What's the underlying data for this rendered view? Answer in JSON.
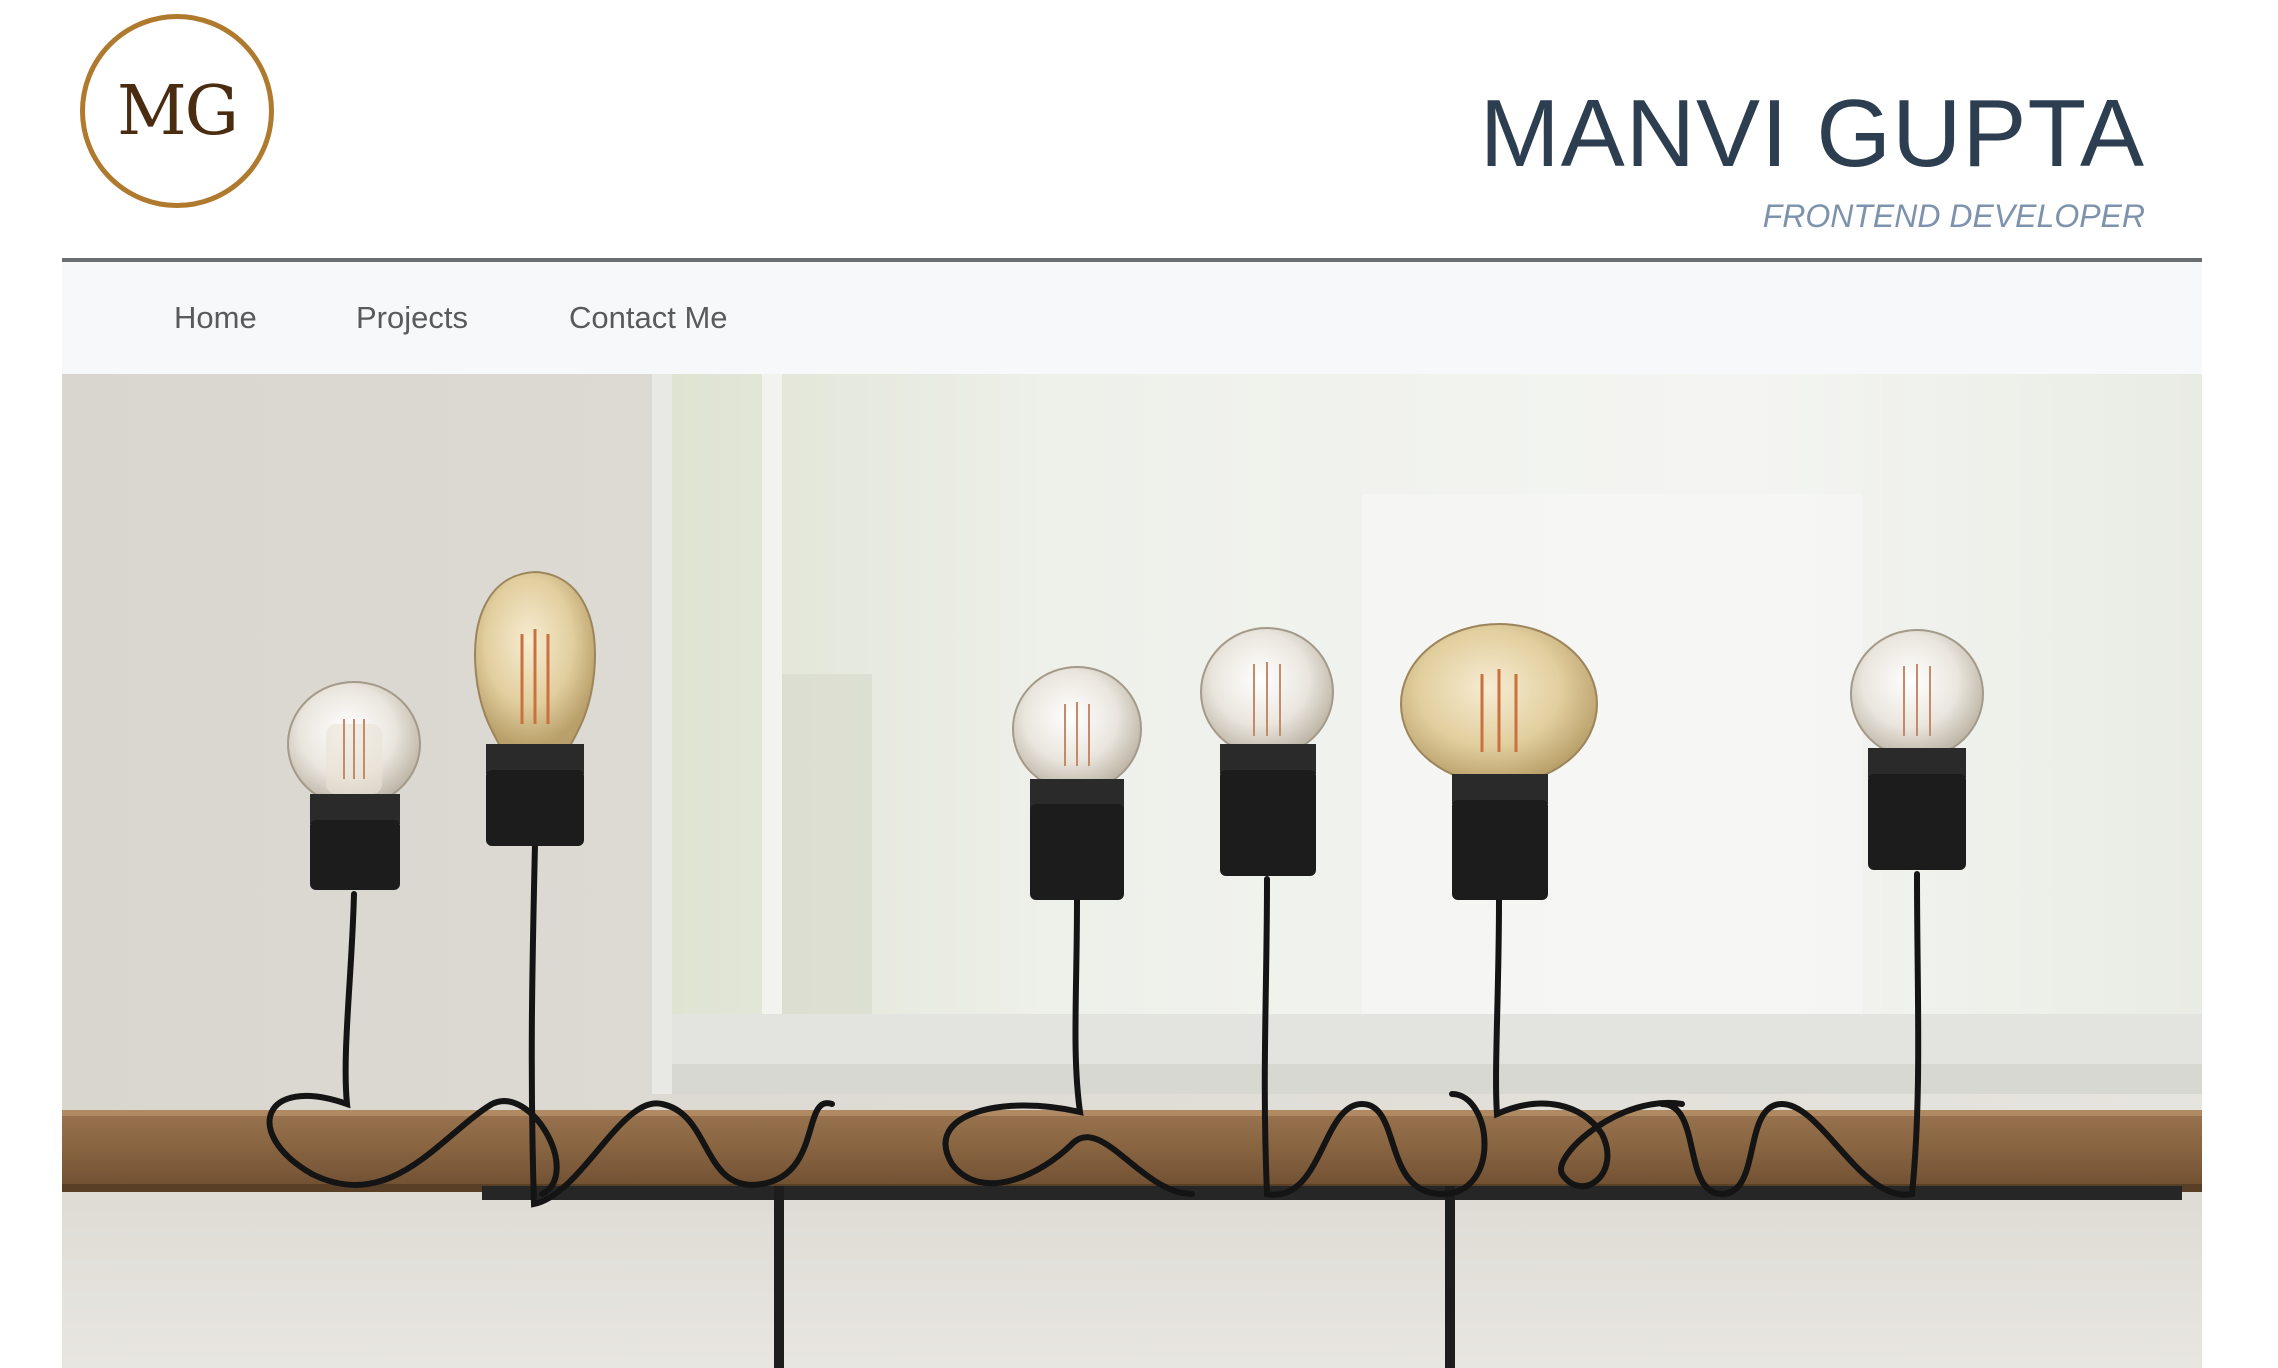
{
  "header": {
    "logo_text": "MG",
    "title": "MANVI GUPTA",
    "subtitle": "FRONTEND DEVELOPER"
  },
  "nav": {
    "items": [
      {
        "label": "Home"
      },
      {
        "label": "Projects"
      },
      {
        "label": "Contact Me"
      }
    ]
  },
  "hero": {
    "image": "light-bulbs-on-wooden-shelf"
  },
  "colors": {
    "title": "#2c3e50",
    "subtitle": "#7d93ad",
    "logo_ring": "#b07a2e",
    "logo_text": "#4a2d10",
    "nav_bg": "#f6f8fa",
    "nav_border": "#6b6f72",
    "nav_text": "#5a5a5a"
  }
}
